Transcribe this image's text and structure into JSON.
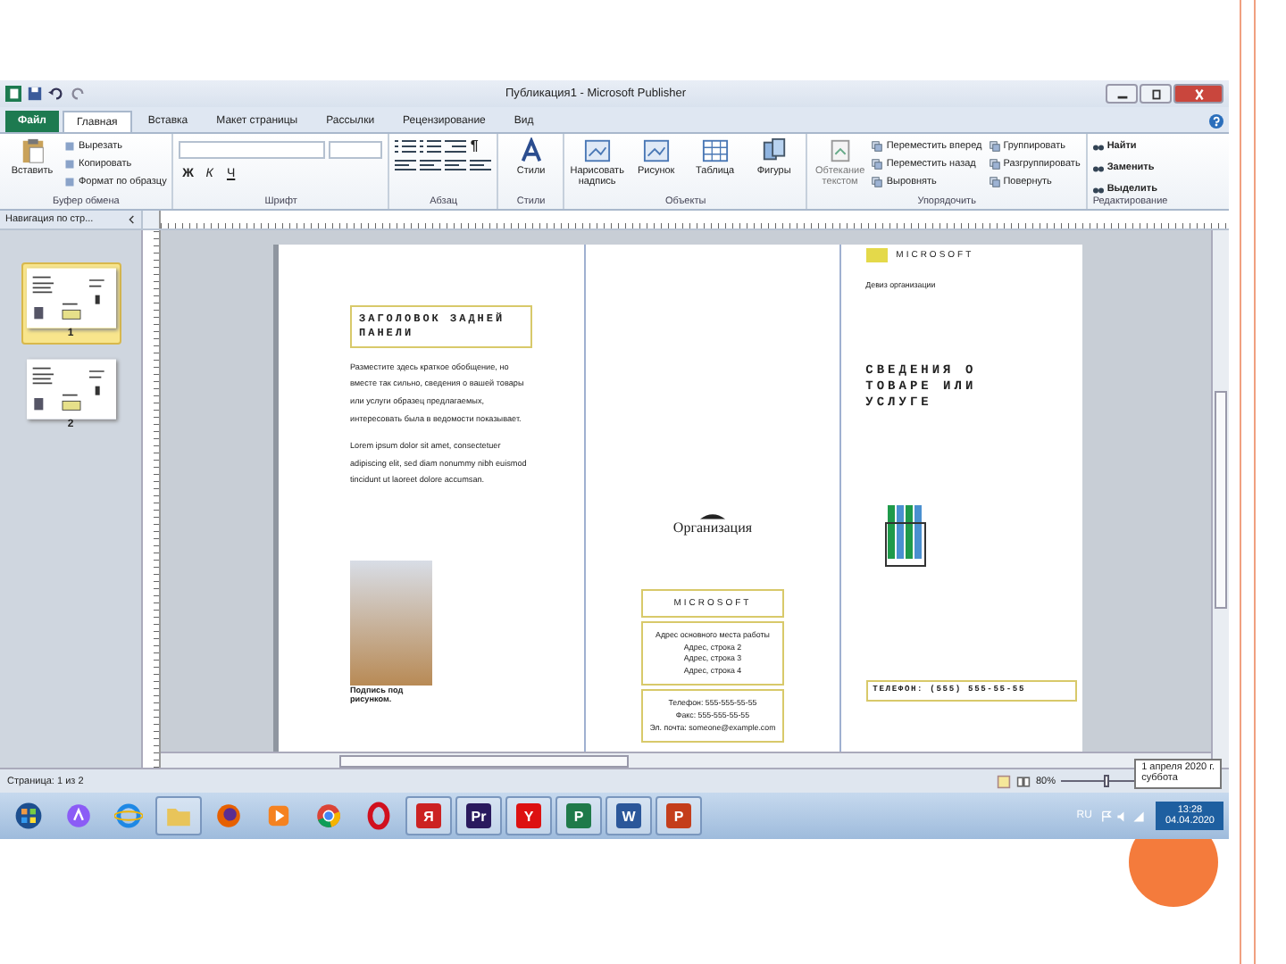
{
  "window": {
    "title": "Публикация1 - Microsoft Publisher"
  },
  "tabs": [
    {
      "label": "Файл",
      "kind": "file",
      "selected": false
    },
    {
      "label": "Главная",
      "kind": "tab",
      "selected": true
    },
    {
      "label": "Вставка",
      "kind": "tab",
      "selected": false
    },
    {
      "label": "Макет страницы",
      "kind": "tab",
      "selected": false
    },
    {
      "label": "Рассылки",
      "kind": "tab",
      "selected": false
    },
    {
      "label": "Рецензирование",
      "kind": "tab",
      "selected": false
    },
    {
      "label": "Вид",
      "kind": "tab",
      "selected": false
    }
  ],
  "ribbon": {
    "clipboard": {
      "label": "Буфер обмена",
      "paste": "Вставить",
      "buttons": [
        "Вырезать",
        "Копировать",
        "Формат по образцу"
      ]
    },
    "font": {
      "label": "Шрифт",
      "format_buttons": [
        "Ж",
        "К",
        "Ч"
      ]
    },
    "paragraph": {
      "label": "Абзац",
      "mark": "¶"
    },
    "styles": {
      "label": "Стили",
      "button": "Стили"
    },
    "objects": {
      "label": "Объекты",
      "buttons": [
        "Нарисовать надпись",
        "Рисунок",
        "Таблица",
        "Фигуры"
      ]
    },
    "arrange": {
      "label": "Упорядочить",
      "wrap": "Обтекание текстом",
      "buttons": [
        "Переместить вперед",
        "Переместить назад",
        "Выровнять",
        "Группировать",
        "Разгруппировать",
        "Повернуть"
      ]
    },
    "editing": {
      "label": "Редактирование",
      "buttons": [
        "Найти",
        "Заменить",
        "Выделить"
      ]
    }
  },
  "nav_pane": {
    "title": "Навигация по стр...",
    "pages": [
      {
        "number": "1",
        "selected": true
      },
      {
        "number": "2",
        "selected": false
      }
    ]
  },
  "page": {
    "panel_1": {
      "heading": "ЗАГОЛОВОК ЗАДНЕЙ ПАНЕЛИ",
      "paragraphs": [
        "Разместите здесь краткое обобщение, но вместе так сильно, сведения о вашей товары или услуги образец предлагаемых, интересовать была в ведомости показывает.",
        "Lorem ipsum dolor sit amet, consectetuer adipiscing elit, sed diam nonummy nibh euismod tincidunt ut laoreet dolore accumsan."
      ],
      "caption": "Подпись под рисунком."
    },
    "panel_2": {
      "organization": "Организация",
      "company": "MICROSOFT",
      "address": [
        "Адрес основного места работы",
        "Адрес, строка 2",
        "Адрес, строка 3",
        "Адрес, строка 4"
      ],
      "contacts": [
        "Телефон: 555-555-55-55",
        "Факс: 555-555-55-55",
        "Эл. почта: someone@example.com"
      ]
    },
    "panel_3": {
      "company": "MICROSOFT",
      "motto": "Девиз организации",
      "title": "СВЕДЕНИЯ О ТОВАРЕ ИЛИ УСЛУГЕ",
      "phone": "ТЕЛЕФОН: (555) 555-55-55"
    }
  },
  "status_bar": {
    "page_info": "Страница: 1 из 2",
    "zoom": "80%",
    "zoom_slider": {
      "level": 0.5
    }
  },
  "date_tooltip": {
    "date": "1 апреля 2020 г.",
    "day": "суббота"
  },
  "taskbar": {
    "apps": [
      {
        "kind": "assistant"
      },
      {
        "kind": "ie"
      },
      {
        "kind": "folder"
      },
      {
        "kind": "firefox"
      },
      {
        "kind": "player"
      },
      {
        "kind": "chrome"
      },
      {
        "kind": "opera"
      },
      {
        "kind": "letter",
        "label": "Я",
        "color": "#cc2222"
      },
      {
        "kind": "letter",
        "label": "Pr",
        "color": "#2a1a5e"
      },
      {
        "kind": "letter",
        "label": "Y",
        "color": "#dd1111"
      },
      {
        "kind": "letter",
        "label": "P",
        "color": "#1f7a4a"
      },
      {
        "kind": "letter",
        "label": "W",
        "color": "#2b579a"
      },
      {
        "kind": "letter",
        "label": "P",
        "color": "#c43e1c"
      }
    ],
    "language": "RU",
    "time": "13:28",
    "date": "04.04.2020"
  }
}
